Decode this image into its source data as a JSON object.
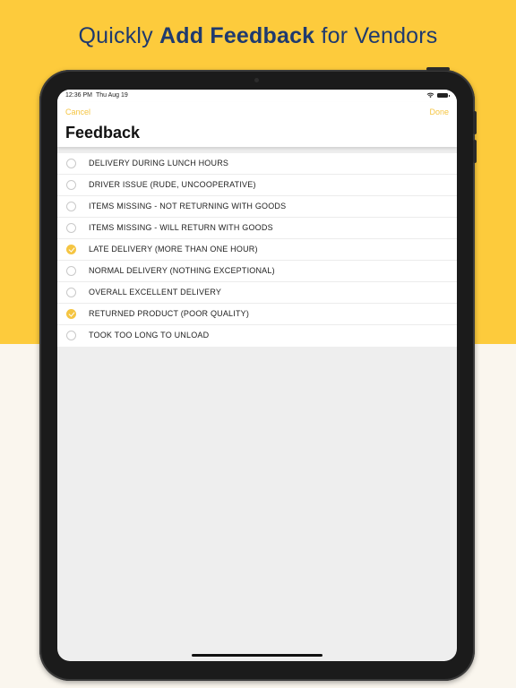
{
  "headline": {
    "part1": "Quickly ",
    "part2": "Add Feedback",
    "part3": " for Vendors"
  },
  "status_bar": {
    "time": "12:36 PM",
    "date": "Thu Aug 19"
  },
  "header": {
    "cancel_label": "Cancel",
    "done_label": "Done",
    "title": "Feedback"
  },
  "feedback_items": [
    {
      "label": "DELIVERY DURING LUNCH HOURS",
      "checked": false
    },
    {
      "label": "DRIVER ISSUE (RUDE, UNCOOPERATIVE)",
      "checked": false
    },
    {
      "label": "ITEMS MISSING - NOT RETURNING WITH GOODS",
      "checked": false
    },
    {
      "label": "ITEMS MISSING - WILL RETURN WITH GOODS",
      "checked": false
    },
    {
      "label": "LATE DELIVERY (MORE THAN ONE HOUR)",
      "checked": true
    },
    {
      "label": "NORMAL DELIVERY (NOTHING EXCEPTIONAL)",
      "checked": false
    },
    {
      "label": "OVERALL EXCELLENT DELIVERY",
      "checked": false
    },
    {
      "label": "RETURNED PRODUCT (POOR QUALITY)",
      "checked": true
    },
    {
      "label": "TOOK TOO LONG TO UNLOAD",
      "checked": false
    }
  ],
  "icons": {
    "wifi": "wifi-icon",
    "battery": "battery-icon",
    "radio_checked": "checkmark-circle-icon",
    "radio_unchecked": "empty-circle-icon"
  },
  "colors": {
    "brand_yellow": "#fdcb3c",
    "accent": "#f5c542",
    "headline_navy": "#1f3a6e",
    "lower_background": "#faf6ee"
  }
}
